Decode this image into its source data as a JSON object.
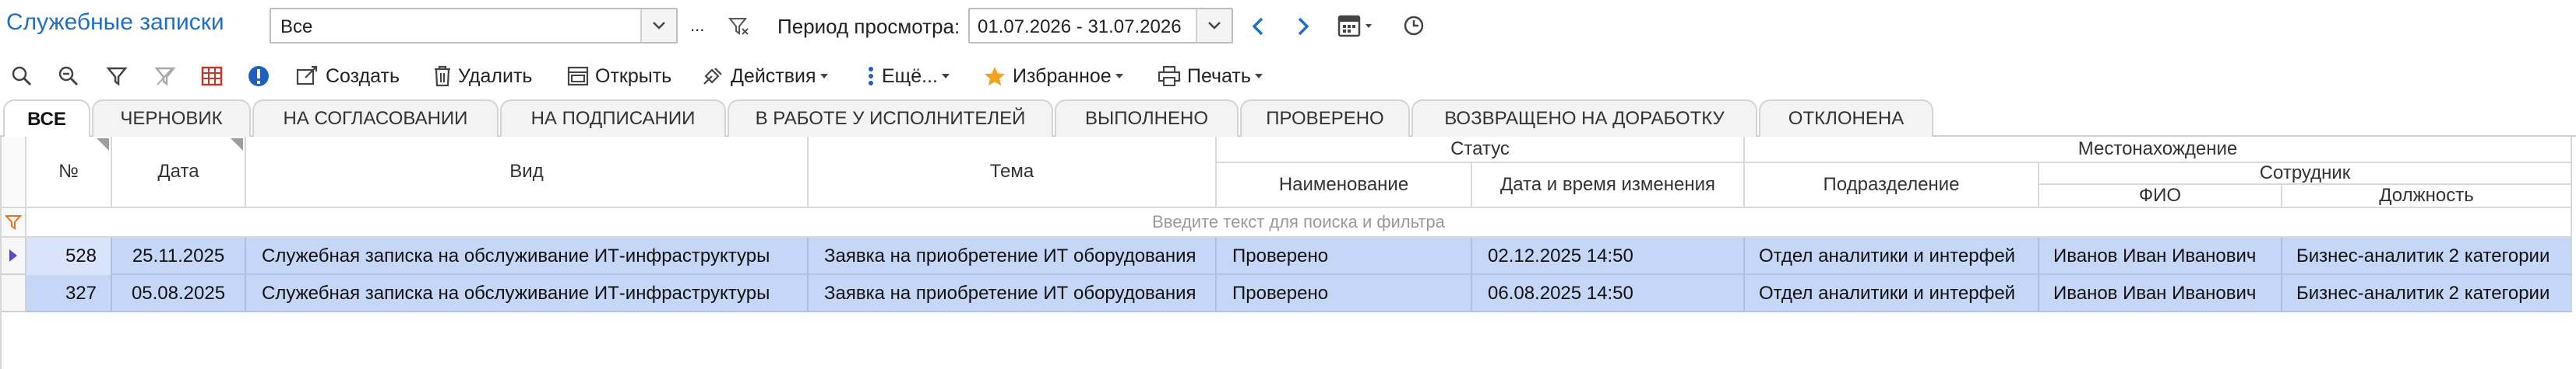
{
  "header": {
    "title": "Служебные записки",
    "filter_value": "Все",
    "ellipsis": "...",
    "period_label": "Период просмотра:",
    "period_value": "01.07.2026 - 31.07.2026"
  },
  "toolbar": {
    "create": "Создать",
    "delete": "Удалить",
    "open": "Открыть",
    "actions": "Действия",
    "more": "Ещё...",
    "favorites": "Избранное",
    "print": "Печать"
  },
  "tabs": [
    {
      "label": "ВСЕ"
    },
    {
      "label": "ЧЕРНОВИК"
    },
    {
      "label": "НА СОГЛАСОВАНИИ"
    },
    {
      "label": "НА ПОДПИСАНИИ"
    },
    {
      "label": "В РАБОТЕ У ИСПОЛНИТЕЛЕЙ"
    },
    {
      "label": "ВЫПОЛНЕНО"
    },
    {
      "label": "ПРОВЕРЕНО"
    },
    {
      "label": "ВОЗВРАЩЕНО НА ДОРАБОТКУ"
    },
    {
      "label": "ОТКЛОНЕНА"
    }
  ],
  "columns": {
    "num": "№",
    "date": "Дата",
    "type": "Вид",
    "subject": "Тема",
    "status": "Статус",
    "status_name": "Наименование",
    "status_changed": "Дата и время изменения",
    "location": "Местонахождение",
    "department": "Подразделение",
    "employee": "Сотрудник",
    "fio": "ФИО",
    "position": "Должность"
  },
  "filter_placeholder": "Введите текст для поиска и фильтра",
  "rows": [
    {
      "num": "528",
      "date": "25.11.2025",
      "type": "Служебная записка на обслуживание ИТ-инфраструктуры",
      "subject": "Заявка на приобретение ИТ оборудования",
      "status": "Проверено",
      "changed": "02.12.2025 14:50",
      "department": "Отдел аналитики и интерфей",
      "fio": "Иванов Иван Иванович",
      "position": "Бизнес-аналитик 2 категории"
    },
    {
      "num": "327",
      "date": "05.08.2025",
      "type": "Служебная записка на обслуживание ИТ-инфраструктуры",
      "subject": "Заявка на приобретение ИТ оборудования",
      "status": "Проверено",
      "changed": "06.08.2025 14:50",
      "department": "Отдел аналитики и интерфей",
      "fio": "Иванов Иван Иванович",
      "position": "Бизнес-аналитик 2 категории"
    }
  ],
  "colors": {
    "accent": "#1f6fc5",
    "selection": "#c6d6f7",
    "star": "#f2a31b",
    "filter_orange": "#e8731a"
  }
}
